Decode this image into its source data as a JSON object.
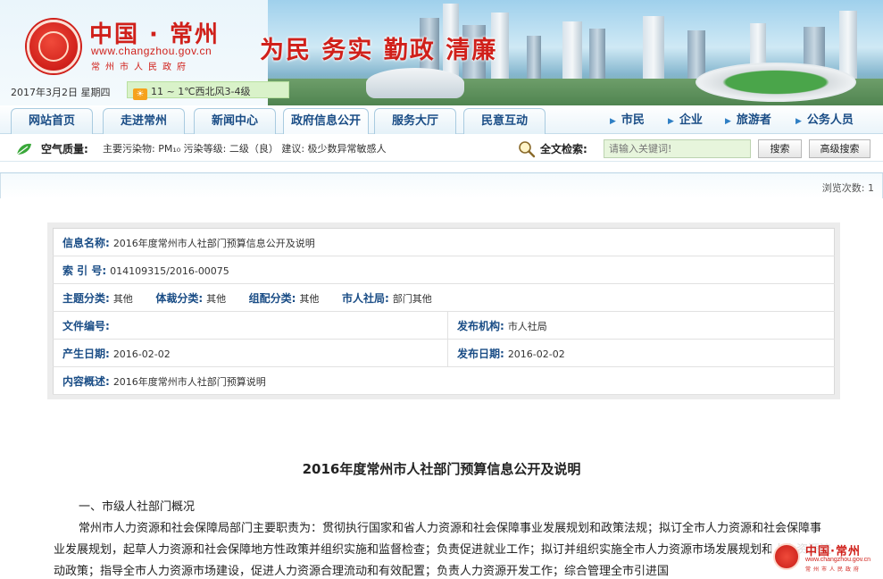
{
  "header": {
    "site_title": "中国 · 常州",
    "site_url": "www.changzhou.gov.cn",
    "site_sub": "常州市人民政府",
    "date": "2017年3月2日  星期四",
    "weather": "11 ~ 1℃西北风3-4级",
    "slogan": "为民 务实 勤政 清廉"
  },
  "nav": {
    "tabs": [
      "网站首页",
      "走进常州",
      "新闻中心",
      "政府信息公开",
      "服务大厅",
      "民意互动"
    ],
    "audiences": [
      "市民",
      "企业",
      "旅游者",
      "公务人员"
    ]
  },
  "toolbar": {
    "air_quality_label": "空气质量:",
    "air_quality_text": "主要污染物: PM₁₀ 污染等级: 二级（良） 建议: 极少数异常敏感人",
    "search_label": "全文检索:",
    "search_placeholder": "请输入关键词!",
    "search_button": "搜索",
    "advanced_button": "高级搜索"
  },
  "content": {
    "view_count": "浏览次数: 1",
    "info": {
      "name_label": "信息名称:",
      "name_value": "2016年度常州市人社部门预算信息公开及说明",
      "index_label": "索 引 号:",
      "index_value": "014109315/2016-00075",
      "topic_label": "主题分类:",
      "topic_value": "其他",
      "genre_label": "体裁分类:",
      "genre_value": "其他",
      "org_label": "组配分类:",
      "org_value": "其他",
      "bureau_label": "市人社局:",
      "bureau_value": "部门其他",
      "docno_label": "文件编号:",
      "docno_value": "",
      "publisher_label": "发布机构:",
      "publisher_value": "市人社局",
      "created_label": "产生日期:",
      "created_value": "2016-02-02",
      "published_label": "发布日期:",
      "published_value": "2016-02-02",
      "summary_label": "内容概述:",
      "summary_value": "2016年度常州市人社部门预算说明"
    },
    "doc_title": "2016年度常州市人社部门预算信息公开及说明",
    "section_1": "一、市级人社部门概况",
    "body": "常州市人力资源和社会保障局部门主要职责为：贯彻执行国家和省人力资源和社会保障事业发展规划和政策法规；拟订全市人力资源和社会保障事业发展规划，起草人力资源和社会保障地方性政策并组织实施和监督检查；负责促进就业工作；拟订并组织实施全市人力资源市场发展规划和人力资源流动政策；指导全市人力资源市场建设，促进人力资源合理流动和有效配置；负责人力资源开发工作；综合管理全市引进国"
  },
  "float_badge": {
    "title": "中国·常州",
    "url": "www.changzhou.gov.cn",
    "sub": "常州市人民政府"
  }
}
